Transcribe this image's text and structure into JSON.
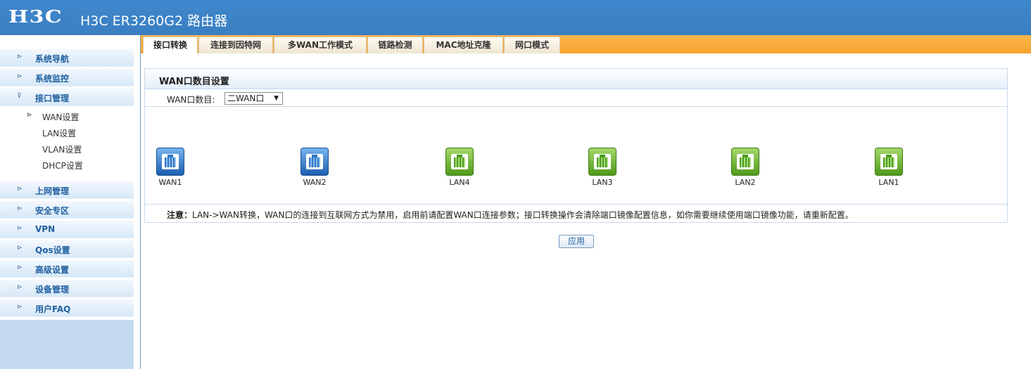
{
  "header": {
    "logo": "H3C",
    "title": "H3C ER3260G2 路由器"
  },
  "sidebar": {
    "items": [
      {
        "label": "系统导航"
      },
      {
        "label": "系统监控"
      },
      {
        "label": "接口管理"
      },
      {
        "label": "上网管理"
      },
      {
        "label": "安全专区"
      },
      {
        "label": "VPN"
      },
      {
        "label": "Qos设置"
      },
      {
        "label": "高级设置"
      },
      {
        "label": "设备管理"
      },
      {
        "label": "用户FAQ"
      }
    ],
    "sub_items": [
      {
        "label": "WAN设置"
      },
      {
        "label": "LAN设置"
      },
      {
        "label": "VLAN设置"
      },
      {
        "label": "DHCP设置"
      }
    ]
  },
  "tabs": [
    {
      "label": "接口转换"
    },
    {
      "label": "连接到因特网"
    },
    {
      "label": "多WAN工作模式"
    },
    {
      "label": "链路检测"
    },
    {
      "label": "MAC地址克隆"
    },
    {
      "label": "网口模式"
    }
  ],
  "panel": {
    "title": "WAN口数目设置",
    "wan_count_label": "WAN口数目:",
    "wan_count_value": "二WAN口",
    "ports": [
      {
        "label": "WAN1",
        "type": "wan"
      },
      {
        "label": "WAN2",
        "type": "wan"
      },
      {
        "label": "LAN4",
        "type": "lan"
      },
      {
        "label": "LAN3",
        "type": "lan"
      },
      {
        "label": "LAN2",
        "type": "lan"
      },
      {
        "label": "LAN1",
        "type": "lan"
      }
    ],
    "note_prefix": "注意：",
    "note_text": "LAN->WAN转换，WAN口的连接到互联网方式为禁用，启用前请配置WAN口连接参数；接口转换操作会清除端口镜像配置信息，如你需要继续使用端口镜像功能，请重新配置。"
  },
  "apply_label": "应用",
  "colors": {
    "header": "#3f87cc",
    "tabbar": "#f5a22b",
    "nav_text": "#1f5f9f",
    "wan_port": "#1b5eb0",
    "lan_port": "#4f9a1b"
  }
}
